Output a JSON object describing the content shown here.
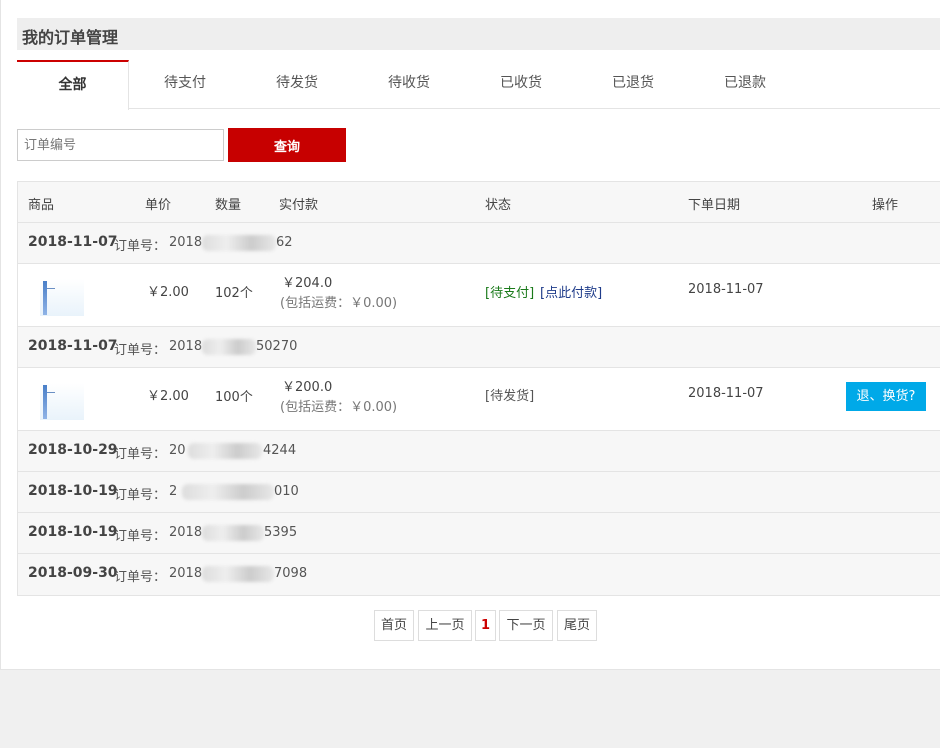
{
  "page_title": "我的订单管理",
  "tabs": [
    {
      "label": "全部",
      "active": true
    },
    {
      "label": "待支付"
    },
    {
      "label": "待发货"
    },
    {
      "label": "待收货"
    },
    {
      "label": "已收货"
    },
    {
      "label": "已退货"
    },
    {
      "label": "已退款"
    }
  ],
  "search": {
    "placeholder": "订单编号",
    "button_label": "查询"
  },
  "table": {
    "headers": {
      "product": "商品",
      "price": "单价",
      "qty": "数量",
      "paid": "实付款",
      "status": "状态",
      "date": "下单日期",
      "action": "操作"
    },
    "order_label": "订单号：",
    "orders": [
      {
        "date": "2018-11-07",
        "num_prefix": "2018",
        "num_suffix": "62",
        "item": {
          "price": "￥2.00",
          "qty": "102个",
          "paid": "￥204.0",
          "shipping": "(包括运费：￥0.00)",
          "status": "[待支付]",
          "status_link": "[点此付款]",
          "order_date": "2018-11-07"
        }
      },
      {
        "date": "2018-11-07",
        "num_prefix": "2018",
        "num_suffix": "50270",
        "item": {
          "price": "￥2.00",
          "qty": "100个",
          "paid": "￥200.0",
          "shipping": "(包括运费：￥0.00)",
          "status": "[待发货]",
          "order_date": "2018-11-07",
          "action": "退、换货?"
        }
      },
      {
        "date": "2018-10-29",
        "num_prefix": "20",
        "num_suffix": "4244"
      },
      {
        "date": "2018-10-19",
        "num_prefix": "2",
        "num_suffix": "010"
      },
      {
        "date": "2018-10-19",
        "num_prefix": "2018",
        "num_suffix": "5395"
      },
      {
        "date": "2018-09-30",
        "num_prefix": "2018",
        "num_suffix": "7098"
      }
    ]
  },
  "pagination": {
    "first": "首页",
    "prev": "上一页",
    "current": "1",
    "next": "下一页",
    "last": "尾页"
  },
  "colors": {
    "accent": "#c70000",
    "action": "#00a9e8",
    "status_green": "#1a7a1a",
    "status_blue": "#1f3c8a"
  }
}
